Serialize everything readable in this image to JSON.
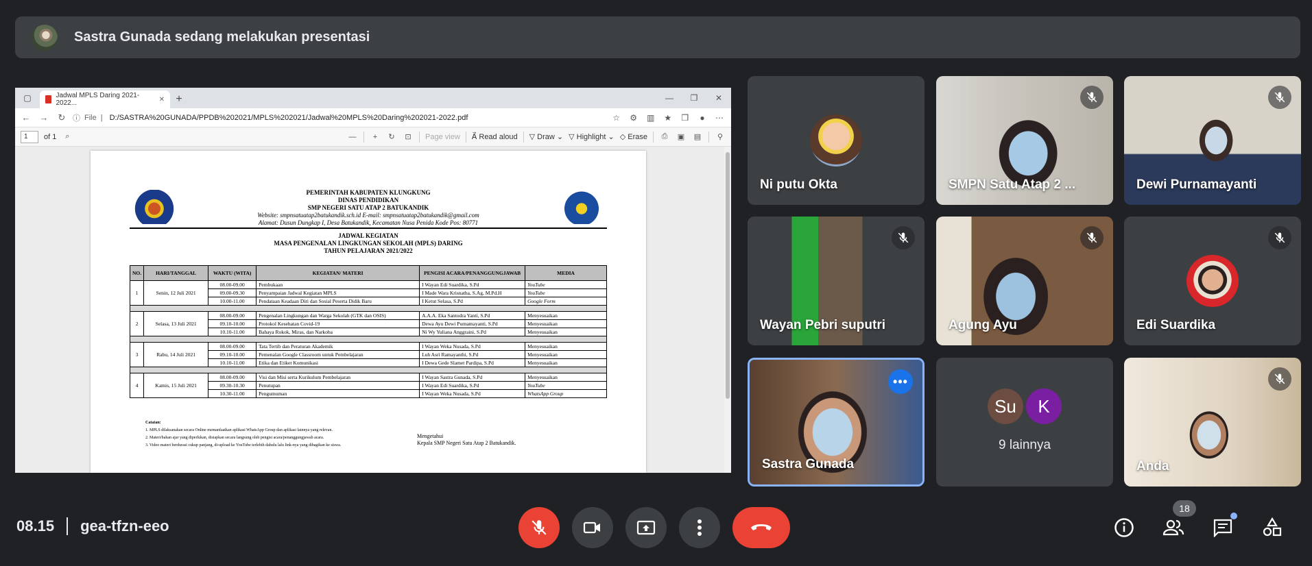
{
  "banner": {
    "text": "Sastra Gunada sedang melakukan presentasi"
  },
  "browser": {
    "tab_title": "Jadwal MPLS Daring 2021-2022...",
    "file_label": "File",
    "url": "D:/SASTRA%20GUNADA/PPDB%202021/MPLS%202021/Jadwal%20MPLS%20Daring%202021-2022.pdf"
  },
  "pdf_toolbar": {
    "page_value": "1",
    "page_of": "of 1",
    "page_view": "Page view",
    "read_aloud": "Read aloud",
    "draw": "Draw",
    "highlight": "Highlight",
    "erase": "Erase"
  },
  "document": {
    "kop": [
      "PEMERINTAH KABUPATEN KLUNGKUNG",
      "DINAS PENDIDIKAN",
      "SMP NEGERI SATU ATAP 2 BATUKANDIK"
    ],
    "website": "Website: smpnsatuatap2batukandik.sch.id E-mail: smpnsatuatap2batukandik@gmail.com",
    "alamat": "Alamat: Dusun Dungkap I, Desa Batukandik, Kecamatan Nusa Penida Kode Pos: 80771",
    "judul": [
      "JADWAL KEGIATAN",
      "MASA PENGENALAN LINGKUNGAN SEKOLAH (MPLS) DARING",
      "TAHUN PELAJARAN 2021/2022"
    ],
    "table_headers": [
      "NO.",
      "HARI/TANGGAL",
      "WAKTU (WITA)",
      "KEGIATAN/ MATERI",
      "PENGISI ACARA/PENANGGUNGJAWAB",
      "MEDIA"
    ],
    "days": [
      {
        "no": "1",
        "hari": "Senin, 12 Juli 2021",
        "rows": [
          [
            "08.00-09.00",
            "Pembukaan",
            "I Wayan Edi Suardika, S.Pd",
            "YouTube"
          ],
          [
            "09.00-09.30",
            "Penyampaian Jadwal Kegiatan MPLS",
            "I Made Wara Krisnatha, S.Ag, M.Pd.H",
            "YouTube"
          ],
          [
            "10.00-11.00",
            "Pendataan Keadaan Diri dan Sosial Peserta Didik Baru",
            "I Ketut Selasa, S.Pd",
            "Google Form"
          ]
        ]
      },
      {
        "no": "2",
        "hari": "Selasa, 13 Juli 2021",
        "rows": [
          [
            "08.00-09.00",
            "Pengenalan Lingkungan dan Warga Sekolah (GTK dan OSIS)",
            "A.A.A. Eka Santodra Yanti, S.Pd",
            "Menyesuaikan"
          ],
          [
            "09.10-10.00",
            "Protokol Kesehatan Covid-19",
            "Dewa Ayu Dewi Purnamayanti, S.Pd",
            "Menyesuaikan"
          ],
          [
            "10.10-11.00",
            "Bahaya Rokok, Miras, dan Narkoba",
            "Ni Wy Yuliana Anggraini, S.Pd",
            "Menyesuaikan"
          ]
        ]
      },
      {
        "no": "3",
        "hari": "Rabu, 14 Juli 2021",
        "rows": [
          [
            "08.00-09.00",
            "Tata Tertib dan Peraturan Akademik",
            "I Wayan Weka Nusada, S.Pd",
            "Menyesuaikan"
          ],
          [
            "09.10-10.00",
            "Pemenalan Google Classroom untuk Pembelajaran",
            "Luh Asri Ramayanthi, S.Pd",
            "Menyesuaikan"
          ],
          [
            "10.10-11.00",
            "Etika dan Etiket Komunikasi",
            "I Dewa Gede Slamet Pardipa, S.Pd",
            "Menyesuaikan"
          ]
        ]
      },
      {
        "no": "4",
        "hari": "Kamis, 15 Juli 2021",
        "rows": [
          [
            "08.00-09.00",
            "Visi dan Misi serta Kurikulum Pembelajaran",
            "I Wayan Sastra Gunada, S.Pd",
            "Menyesuaikan"
          ],
          [
            "09.30-10.30",
            "Penutupan",
            "I Wayan Edi Suardika, S.Pd",
            "YouTube"
          ],
          [
            "10.30-11.00",
            "Pengumuman",
            "I Wayan Weka Nusada, S.Pd",
            "WhatsApp Group"
          ]
        ]
      }
    ],
    "catatan_title": "Catatan:",
    "catatan": [
      "1. MPLS dilaksanakan secara Online memanfaatkan aplikasi WhatsApp Group dan aplikasi lainnya yang relevan.",
      "2. Materi/bahan ajar yang diperlukan, disiapkan secara langsung oleh pengisi acara/penanggungjawab acara.",
      "3. Video materi berdurasi cukup panjang, di-upload ke YouTube terlebih dahulu lalu link-nya yang dibagikan ke siswa."
    ],
    "mengetahui": [
      "Mengetahui",
      "Kepala SMP Negeri Satu Atap 2 Batukandik."
    ]
  },
  "participants": [
    {
      "name": "Ni putu Okta",
      "muted": false
    },
    {
      "name": "SMPN Satu Atap 2 ...",
      "muted": true
    },
    {
      "name": "Dewi Purnamayanti",
      "muted": true
    },
    {
      "name": "Wayan Pebri suputri",
      "muted": true
    },
    {
      "name": "Agung Ayu",
      "muted": true
    },
    {
      "name": "Edi Suardika",
      "muted": true
    },
    {
      "name": "Sastra Gunada",
      "muted": false
    },
    {
      "name": "Anda",
      "muted": true
    }
  ],
  "others_tile": {
    "initials": [
      "Su",
      "K"
    ],
    "label": "9 lainnya"
  },
  "meeting": {
    "time": "08.15",
    "code": "gea-tfzn-eeo",
    "participant_count": "18"
  },
  "colors": {
    "background": "#202124",
    "tile": "#3c4043",
    "danger": "#ea4335",
    "accent": "#1a73e8"
  }
}
